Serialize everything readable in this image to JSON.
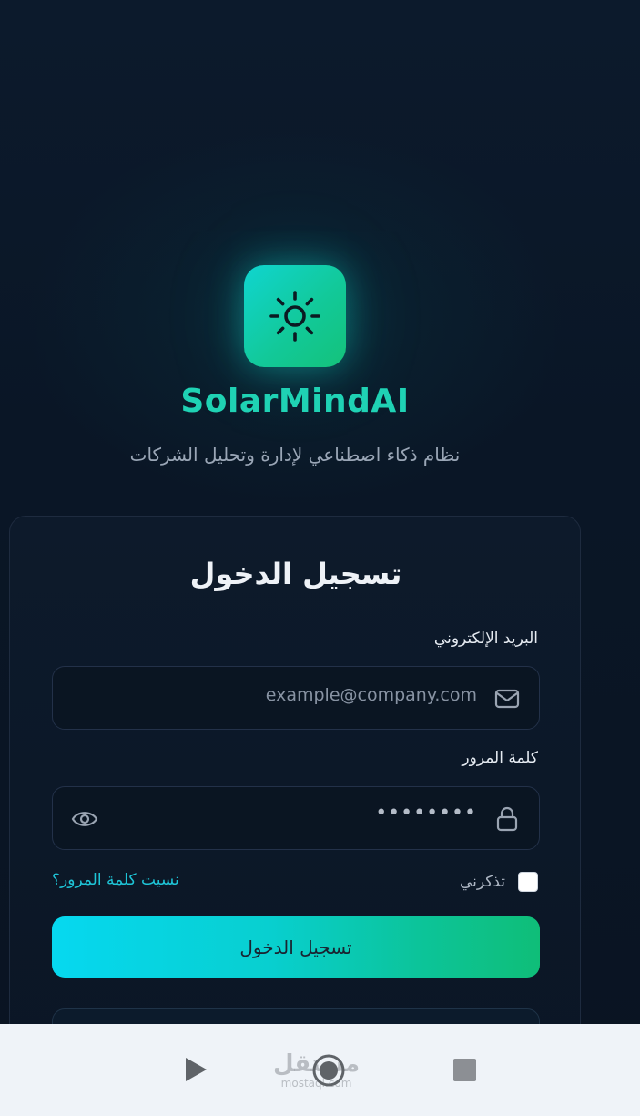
{
  "app": {
    "brand_name": "SolarMindAI",
    "tagline": "نظام ذكاء اصطناعي لإدارة وتحليل الشركات",
    "logo_icon": "sun-icon"
  },
  "login_card": {
    "title": "تسجيل الدخول",
    "email": {
      "label": "البريد الإلكتروني",
      "placeholder": "example@company.com",
      "icon": "mail-icon"
    },
    "password": {
      "label": "كلمة المرور",
      "value_masked": "••••••••",
      "icon": "lock-icon",
      "toggle_icon": "eye-icon"
    },
    "remember_me": {
      "label": "تذكرني",
      "checked": false
    },
    "forgot_password": "نسيت كلمة المرور؟",
    "submit_label": "تسجيل الدخول"
  },
  "nav_bar": {
    "back_icon": "play-icon",
    "home_icon": "home-circle-icon",
    "recent_icon": "square-icon",
    "watermark_ar": "مستقل",
    "watermark_en": "mostaql.com"
  },
  "colors": {
    "brand_teal": "#1fd2b4",
    "link_cyan": "#1ec4d6",
    "background": "#0b1524",
    "button_gradient_start": "#06d8f0",
    "button_gradient_end": "#0fbe78"
  }
}
